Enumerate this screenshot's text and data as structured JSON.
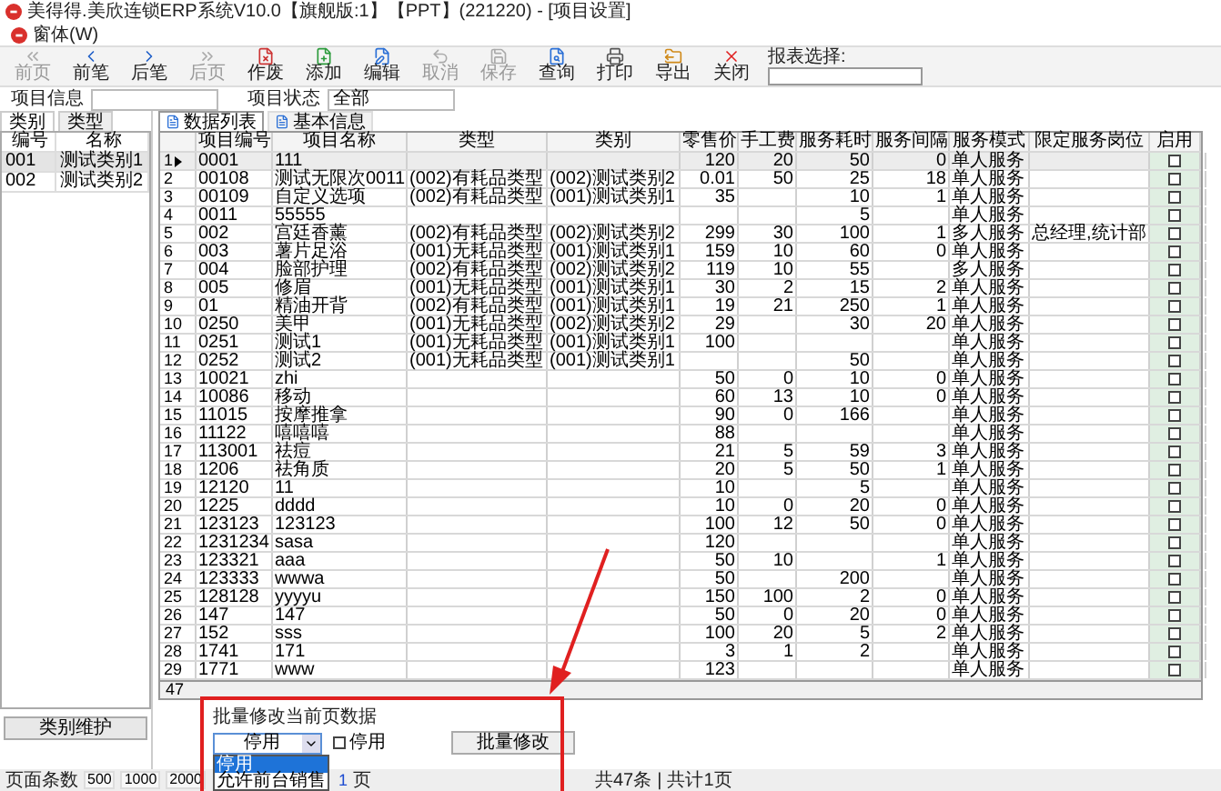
{
  "window": {
    "title": "美得得.美欣连锁ERP系统V10.0【旗舰版:1】【PPT】(221220) - [项目设置]"
  },
  "menu": [
    "窗体(W)"
  ],
  "toolbar": [
    {
      "label": "前页",
      "disabled": true
    },
    {
      "label": "前笔",
      "disabled": false
    },
    {
      "label": "后笔",
      "disabled": false
    },
    {
      "label": "后页",
      "disabled": true
    },
    {
      "label": "作废",
      "disabled": false
    },
    {
      "label": "添加",
      "disabled": false
    },
    {
      "label": "编辑",
      "disabled": false
    },
    {
      "label": "取消",
      "disabled": true
    },
    {
      "label": "保存",
      "disabled": true
    },
    {
      "label": "查询",
      "disabled": false
    },
    {
      "label": "打印",
      "disabled": false
    },
    {
      "label": "导出",
      "disabled": false
    },
    {
      "label": "关闭",
      "disabled": false
    }
  ],
  "report_select": {
    "label": "报表选择:"
  },
  "filters": [
    {
      "label": "项目信息"
    },
    {
      "label": "项目状态",
      "value": "全部"
    }
  ],
  "sidebar": {
    "tabs": [
      {
        "label": "类别",
        "selected": true
      },
      {
        "label": "类型",
        "selected": false
      }
    ],
    "columns": [
      "编号",
      "名称"
    ],
    "rows": [
      {
        "cells": [
          "001",
          "测试类别1"
        ],
        "selected": true
      },
      {
        "cells": [
          "002",
          "测试类别2"
        ],
        "selected": false
      }
    ],
    "button": "类别维护"
  },
  "content_tabs": [
    {
      "label": "数据列表",
      "selected": true
    },
    {
      "label": "基本信息",
      "selected": false
    }
  ],
  "table": {
    "columns": [
      "项目编号",
      "项目名称",
      "类型",
      "类别",
      "零售价",
      "手工费",
      "服务耗时",
      "服务间隔",
      "服务模式",
      "限定服务岗位",
      "启用"
    ],
    "rows": [
      {
        "no": "1",
        "selected": true,
        "enabled": false,
        "cells": [
          "0001",
          "111",
          null,
          null,
          "120",
          "20",
          "50",
          "0",
          "单人服务",
          null
        ]
      },
      {
        "no": "2",
        "selected": false,
        "enabled": false,
        "cells": [
          "00108",
          "测试无限次0011",
          "(002)有耗品类型",
          "(002)测试类别2",
          "0.01",
          "50",
          "25",
          "18",
          "单人服务",
          null
        ]
      },
      {
        "no": "3",
        "selected": false,
        "enabled": false,
        "cells": [
          "00109",
          "自定义选项",
          "(002)有耗品类型",
          "(001)测试类别1",
          "35",
          null,
          "10",
          "1",
          "单人服务",
          null
        ]
      },
      {
        "no": "4",
        "selected": false,
        "enabled": false,
        "cells": [
          "0011",
          "55555",
          null,
          null,
          null,
          null,
          "5",
          null,
          "单人服务",
          null
        ]
      },
      {
        "no": "5",
        "selected": false,
        "enabled": false,
        "cells": [
          "002",
          "宫廷香薰",
          "(002)有耗品类型",
          "(002)测试类别2",
          "299",
          "30",
          "100",
          "1",
          "多人服务",
          "总经理,统计部"
        ]
      },
      {
        "no": "6",
        "selected": false,
        "enabled": false,
        "cells": [
          "003",
          "薯片足浴",
          "(001)无耗品类型",
          "(001)测试类别1",
          "159",
          "10",
          "60",
          "0",
          "单人服务",
          null
        ]
      },
      {
        "no": "7",
        "selected": false,
        "enabled": false,
        "cells": [
          "004",
          "脸部护理",
          "(002)有耗品类型",
          "(002)测试类别2",
          "119",
          "10",
          "55",
          null,
          "多人服务",
          null
        ]
      },
      {
        "no": "8",
        "selected": false,
        "enabled": false,
        "cells": [
          "005",
          "修眉",
          "(001)无耗品类型",
          "(001)测试类别1",
          "30",
          "2",
          "15",
          "2",
          "单人服务",
          null
        ]
      },
      {
        "no": "9",
        "selected": false,
        "enabled": false,
        "cells": [
          "01",
          "精油开背",
          "(002)有耗品类型",
          "(001)测试类别1",
          "19",
          "21",
          "250",
          "1",
          "单人服务",
          null
        ]
      },
      {
        "no": "10",
        "selected": false,
        "enabled": false,
        "cells": [
          "0250",
          "美甲",
          "(001)无耗品类型",
          "(002)测试类别2",
          "29",
          null,
          "30",
          "20",
          "单人服务",
          null
        ]
      },
      {
        "no": "11",
        "selected": false,
        "enabled": false,
        "cells": [
          "0251",
          "测试1",
          "(001)无耗品类型",
          "(001)测试类别1",
          "100",
          null,
          null,
          null,
          "单人服务",
          null
        ]
      },
      {
        "no": "12",
        "selected": false,
        "enabled": false,
        "cells": [
          "0252",
          "测试2",
          "(001)无耗品类型",
          "(001)测试类别1",
          null,
          null,
          "50",
          null,
          "单人服务",
          null
        ]
      },
      {
        "no": "13",
        "selected": false,
        "enabled": false,
        "cells": [
          "10021",
          "zhi",
          null,
          null,
          "50",
          "0",
          "10",
          "0",
          "单人服务",
          null
        ]
      },
      {
        "no": "14",
        "selected": false,
        "enabled": false,
        "cells": [
          "10086",
          "移动",
          null,
          null,
          "60",
          "13",
          "10",
          "0",
          "单人服务",
          null
        ]
      },
      {
        "no": "15",
        "selected": false,
        "enabled": false,
        "cells": [
          "11015",
          "按摩推拿",
          null,
          null,
          "90",
          "0",
          "166",
          null,
          "单人服务",
          null
        ]
      },
      {
        "no": "16",
        "selected": false,
        "enabled": false,
        "cells": [
          "11122",
          "嘻嘻嘻",
          null,
          null,
          "88",
          null,
          null,
          null,
          "单人服务",
          null
        ]
      },
      {
        "no": "17",
        "selected": false,
        "enabled": false,
        "cells": [
          "113001",
          "祛痘",
          null,
          null,
          "21",
          "5",
          "59",
          "3",
          "单人服务",
          null
        ]
      },
      {
        "no": "18",
        "selected": false,
        "enabled": false,
        "cells": [
          "1206",
          "祛角质",
          null,
          null,
          "20",
          "5",
          "50",
          "1",
          "单人服务",
          null
        ]
      },
      {
        "no": "19",
        "selected": false,
        "enabled": false,
        "cells": [
          "12120",
          "11",
          null,
          null,
          "10",
          null,
          "5",
          null,
          "单人服务",
          null
        ]
      },
      {
        "no": "20",
        "selected": false,
        "enabled": false,
        "cells": [
          "1225",
          "dddd",
          null,
          null,
          "10",
          "0",
          "20",
          "0",
          "单人服务",
          null
        ]
      },
      {
        "no": "21",
        "selected": false,
        "enabled": false,
        "cells": [
          "123123",
          "123123",
          null,
          null,
          "100",
          "12",
          "50",
          "0",
          "单人服务",
          null
        ]
      },
      {
        "no": "22",
        "selected": false,
        "enabled": false,
        "cells": [
          "1231234",
          "sasa",
          null,
          null,
          "120",
          null,
          null,
          null,
          "单人服务",
          null
        ]
      },
      {
        "no": "23",
        "selected": false,
        "enabled": false,
        "cells": [
          "123321",
          "aaa",
          null,
          null,
          "50",
          "10",
          null,
          "1",
          "单人服务",
          null
        ]
      },
      {
        "no": "24",
        "selected": false,
        "enabled": false,
        "cells": [
          "123333",
          "wwwa",
          null,
          null,
          "50",
          null,
          "200",
          null,
          "单人服务",
          null
        ]
      },
      {
        "no": "25",
        "selected": false,
        "enabled": false,
        "cells": [
          "128128",
          "yyyyu",
          null,
          null,
          "150",
          "100",
          "2",
          "0",
          "单人服务",
          null
        ]
      },
      {
        "no": "26",
        "selected": false,
        "enabled": false,
        "cells": [
          "147",
          "147",
          null,
          null,
          "50",
          "0",
          "20",
          "0",
          "单人服务",
          null
        ]
      },
      {
        "no": "27",
        "selected": false,
        "enabled": false,
        "cells": [
          "152",
          "sss",
          null,
          null,
          "100",
          "20",
          "5",
          "2",
          "单人服务",
          null
        ]
      },
      {
        "no": "28",
        "selected": false,
        "enabled": false,
        "cells": [
          "1741",
          "171",
          null,
          null,
          "3",
          "1",
          "2",
          null,
          "单人服务",
          null
        ]
      },
      {
        "no": "29",
        "selected": false,
        "enabled": false,
        "cells": [
          "1771",
          "www",
          null,
          null,
          "123",
          null,
          null,
          null,
          "单人服务",
          null
        ]
      }
    ],
    "footer": "47"
  },
  "batch_edit": {
    "title": "批量修改当前页数据",
    "select_value": "停用",
    "options": [
      {
        "label": "停用",
        "selected": true
      },
      {
        "label": "允许前台销售",
        "selected": false
      }
    ],
    "checkbox": {
      "label": "停用",
      "checked": false
    },
    "button": "批量修改"
  },
  "status_bar": {
    "page_size_label": "页面条数",
    "page_sizes": [
      "500",
      "1000",
      "2000"
    ],
    "page": "1",
    "page_unit": "页",
    "total": "共47条",
    "separator": "|",
    "pages": "共计1页"
  }
}
